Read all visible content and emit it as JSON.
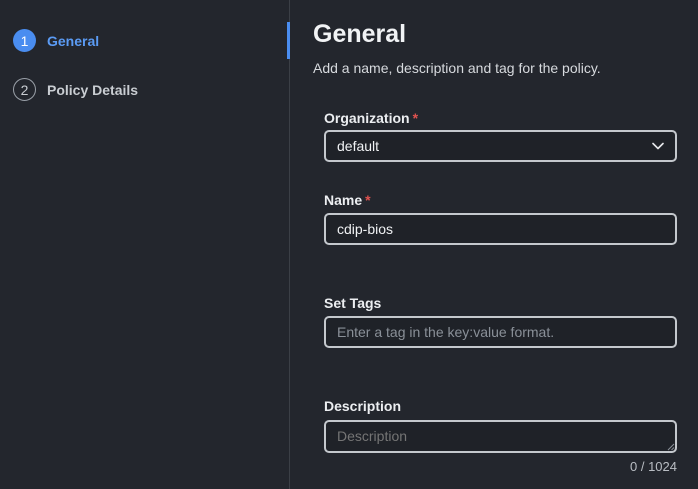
{
  "wizard": {
    "steps": [
      {
        "number": "1",
        "label": "General",
        "state": "active"
      },
      {
        "number": "2",
        "label": "Policy Details",
        "state": "inactive"
      }
    ]
  },
  "main": {
    "title": "General",
    "subtitle": "Add a name, description and tag for the policy.",
    "organization": {
      "label": "Organization",
      "required_mark": "*",
      "value": "default",
      "icon": "chevron-down-icon"
    },
    "name": {
      "label": "Name",
      "required_mark": "*",
      "value": "cdip-bios"
    },
    "tags": {
      "label": "Set Tags",
      "placeholder": "Enter a tag in the key:value format."
    },
    "description": {
      "label": "Description",
      "placeholder": "Description",
      "counter": "0 / 1024"
    }
  },
  "colors": {
    "accent": "#4a8df0",
    "required": "#e0524f",
    "background": "#23262d"
  }
}
